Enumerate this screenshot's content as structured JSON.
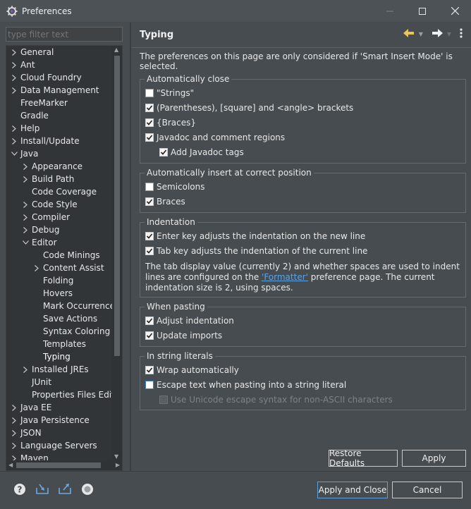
{
  "window": {
    "title": "Preferences"
  },
  "filter": {
    "placeholder": "type filter text"
  },
  "tree": [
    {
      "label": "General",
      "level": 0,
      "arrow": "right"
    },
    {
      "label": "Ant",
      "level": 0,
      "arrow": "right"
    },
    {
      "label": "Cloud Foundry",
      "level": 0,
      "arrow": "right"
    },
    {
      "label": "Data Management",
      "level": 0,
      "arrow": "right"
    },
    {
      "label": "FreeMarker",
      "level": 0,
      "arrow": ""
    },
    {
      "label": "Gradle",
      "level": 0,
      "arrow": ""
    },
    {
      "label": "Help",
      "level": 0,
      "arrow": "right"
    },
    {
      "label": "Install/Update",
      "level": 0,
      "arrow": "right"
    },
    {
      "label": "Java",
      "level": 0,
      "arrow": "down"
    },
    {
      "label": "Appearance",
      "level": 1,
      "arrow": "right"
    },
    {
      "label": "Build Path",
      "level": 1,
      "arrow": "right"
    },
    {
      "label": "Code Coverage",
      "level": 1,
      "arrow": ""
    },
    {
      "label": "Code Style",
      "level": 1,
      "arrow": "right"
    },
    {
      "label": "Compiler",
      "level": 1,
      "arrow": "right"
    },
    {
      "label": "Debug",
      "level": 1,
      "arrow": "right"
    },
    {
      "label": "Editor",
      "level": 1,
      "arrow": "down"
    },
    {
      "label": "Code Minings",
      "level": 2,
      "arrow": ""
    },
    {
      "label": "Content Assist",
      "level": 2,
      "arrow": "right"
    },
    {
      "label": "Folding",
      "level": 2,
      "arrow": ""
    },
    {
      "label": "Hovers",
      "level": 2,
      "arrow": ""
    },
    {
      "label": "Mark Occurrences",
      "level": 2,
      "arrow": ""
    },
    {
      "label": "Save Actions",
      "level": 2,
      "arrow": ""
    },
    {
      "label": "Syntax Coloring",
      "level": 2,
      "arrow": ""
    },
    {
      "label": "Templates",
      "level": 2,
      "arrow": ""
    },
    {
      "label": "Typing",
      "level": 2,
      "arrow": "",
      "selected": true
    },
    {
      "label": "Installed JREs",
      "level": 1,
      "arrow": "right"
    },
    {
      "label": "JUnit",
      "level": 1,
      "arrow": ""
    },
    {
      "label": "Properties Files Edito",
      "level": 1,
      "arrow": ""
    },
    {
      "label": "Java EE",
      "level": 0,
      "arrow": "right"
    },
    {
      "label": "Java Persistence",
      "level": 0,
      "arrow": "right"
    },
    {
      "label": "JSON",
      "level": 0,
      "arrow": "right"
    },
    {
      "label": "Language Servers",
      "level": 0,
      "arrow": "right"
    },
    {
      "label": "Maven",
      "level": 0,
      "arrow": "right"
    }
  ],
  "page": {
    "title": "Typing",
    "intro": "The preferences on this page are only considered if 'Smart Insert Mode' is selected."
  },
  "groups": {
    "auto_close": {
      "title": "Automatically close",
      "options": [
        {
          "label": "\"Strings\"",
          "checked": false
        },
        {
          "label": "(Parentheses), [square] and <angle> brackets",
          "checked": true
        },
        {
          "label": "{Braces}",
          "checked": true
        },
        {
          "label": "Javadoc and comment regions",
          "checked": true
        },
        {
          "label": "Add Javadoc tags",
          "checked": true
        }
      ]
    },
    "auto_insert": {
      "title": "Automatically insert at correct position",
      "options": [
        {
          "label": "Semicolons",
          "checked": false
        },
        {
          "label": "Braces",
          "checked": true
        }
      ]
    },
    "indentation": {
      "title": "Indentation",
      "options": [
        {
          "label": "Enter key adjusts the indentation on the new line",
          "checked": true
        },
        {
          "label": "Tab key adjusts the indentation of the current line",
          "checked": true
        }
      ],
      "info_pre": "The tab display value (currently 2) and whether spaces are used to indent lines are configured on the ",
      "info_link": "'Formatter'",
      "info_post": " preference page. The current indentation size is 2, using spaces."
    },
    "pasting": {
      "title": "When pasting",
      "options": [
        {
          "label": "Adjust indentation",
          "checked": true
        },
        {
          "label": "Update imports",
          "checked": true
        }
      ]
    },
    "string_literals": {
      "title": "In string literals",
      "options": [
        {
          "label": "Wrap automatically",
          "checked": true
        },
        {
          "label": "Escape text when pasting into a string literal",
          "checked": false
        },
        {
          "label": "Use Unicode escape syntax for non-ASCII characters",
          "checked": false,
          "disabled": true
        }
      ]
    }
  },
  "buttons": {
    "restore_defaults": "Restore Defaults",
    "apply": "Apply",
    "apply_and_close": "Apply and Close",
    "cancel": "Cancel"
  },
  "colors": {
    "background": "#474c50",
    "tree_background": "#313538",
    "link": "#5aa3e6",
    "default_button_border": "#5a9fe0"
  }
}
